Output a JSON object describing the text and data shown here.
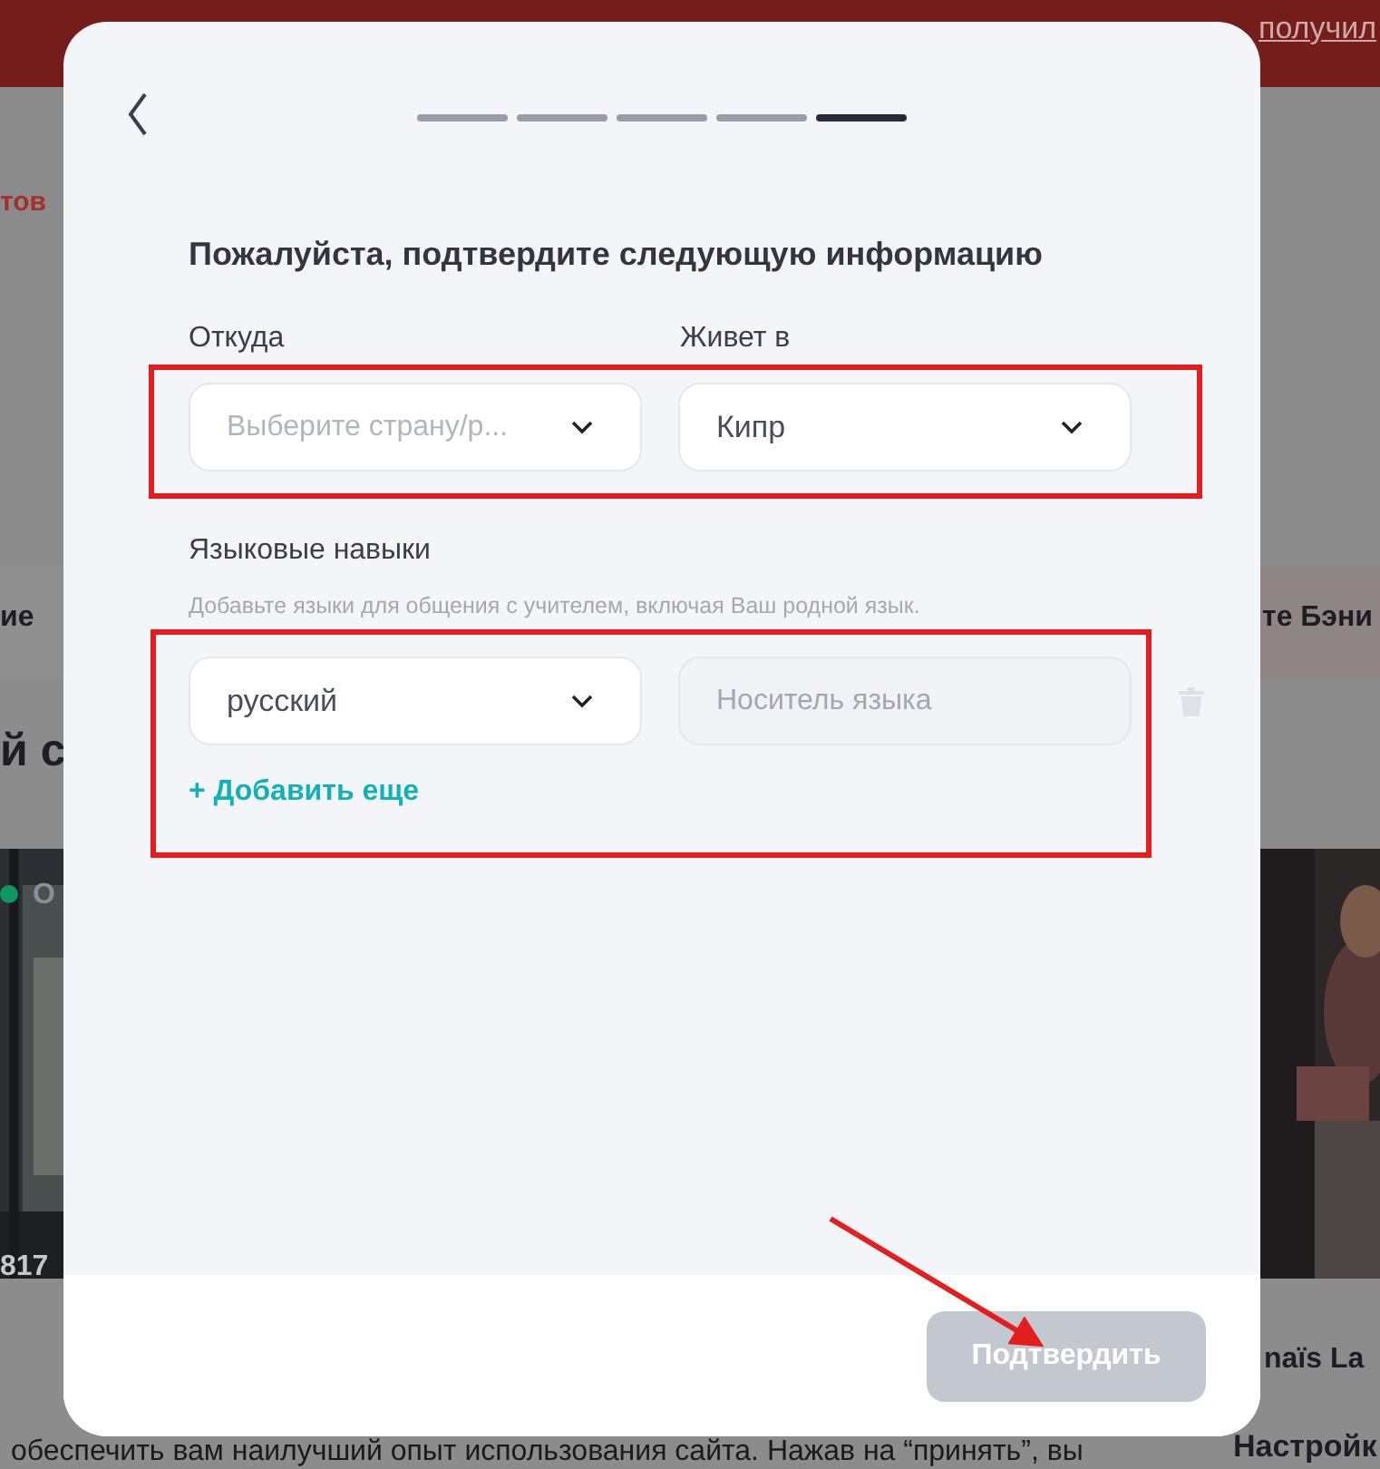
{
  "background": {
    "banner_link": "получил",
    "left_texts": [
      "тов",
      "ие",
      "й с",
      "О",
      "817"
    ],
    "right_texts": [
      "те Бэни",
      "naïs La",
      "Настройк"
    ],
    "cookie_text": "обеспечить вам наилучший опыт использования сайта. Нажав на “принять”, вы"
  },
  "modal": {
    "steps": [
      {
        "selected": false
      },
      {
        "selected": false
      },
      {
        "selected": false
      },
      {
        "selected": false
      },
      {
        "selected": true
      }
    ],
    "title": "Пожалуйста, подтвердите следующую информацию",
    "from": {
      "label": "Откуда",
      "placeholder": "Выберите страну/р..."
    },
    "lives_in": {
      "label": "Живет в",
      "value": "Кипр"
    },
    "languages": {
      "label": "Языковые навыки",
      "hint": "Добавьте языки для общения с учителем, включая Ваш родной язык.",
      "rows": [
        {
          "language": "русский",
          "level_placeholder": "Носитель языка"
        }
      ],
      "add_more": "+ Добавить еще"
    },
    "submit": {
      "label": "Подтвердить",
      "disabled": true
    }
  }
}
